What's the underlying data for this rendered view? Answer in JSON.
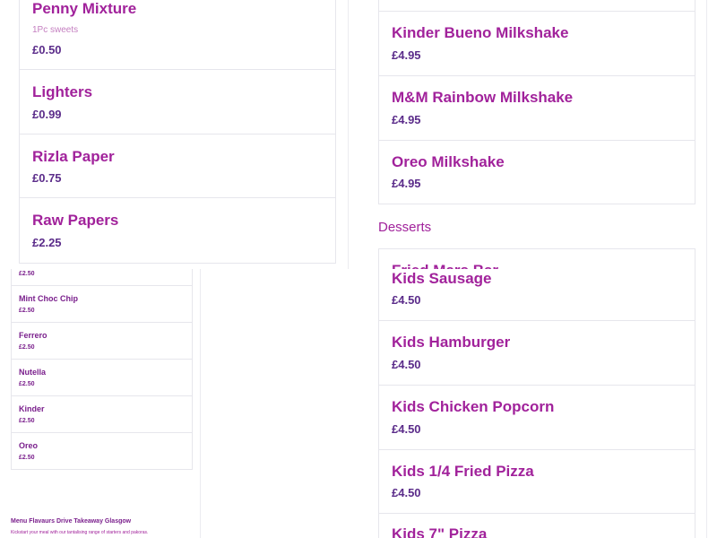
{
  "top_left": [
    {
      "name": "Penny Mixture",
      "desc": "1Pc sweets",
      "price": "£0.50"
    },
    {
      "name": "Lighters",
      "price": "£0.99"
    },
    {
      "name": "Rizla Paper",
      "price": "£0.75"
    },
    {
      "name": "Raw Papers",
      "price": "£2.25"
    }
  ],
  "top_right": [
    {
      "name": "Kinder Bueno Milkshake",
      "price": "£4.95"
    },
    {
      "name": "M&M Rainbow Milkshake",
      "price": "£4.95"
    },
    {
      "name": "Oreo Milkshake",
      "price": "£4.95"
    }
  ],
  "top_right_section": "Desserts",
  "top_right_next": "Fried Mars Bar",
  "bottom_left_first_price": "£2.50",
  "bottom_left": [
    {
      "name": "Mint Choc Chip",
      "price": "£2.50"
    },
    {
      "name": "Ferrero",
      "price": "£2.50"
    },
    {
      "name": "Nutella",
      "price": "£2.50"
    },
    {
      "name": "Kinder",
      "price": "£2.50"
    },
    {
      "name": "Oreo",
      "price": "£2.50"
    }
  ],
  "footer": {
    "title": "Menu Flavaurs Drive Takeaway Glasgow",
    "subtitle": "Kickstart your meal with our tantalising range of starters and pakoras."
  },
  "bottom_right": [
    {
      "name": "Kids Sausage",
      "price": "£4.50"
    },
    {
      "name": "Kids Hamburger",
      "price": "£4.50"
    },
    {
      "name": "Kids Chicken Popcorn",
      "price": "£4.50"
    },
    {
      "name": "Kids 1/4 Fried Pizza",
      "price": "£4.50"
    },
    {
      "name": "Kids 7\" Pizza",
      "price": ""
    }
  ],
  "colors": {
    "accent": "#a1229b",
    "price": "#5b2c8a",
    "border": "#e6e6ec"
  }
}
